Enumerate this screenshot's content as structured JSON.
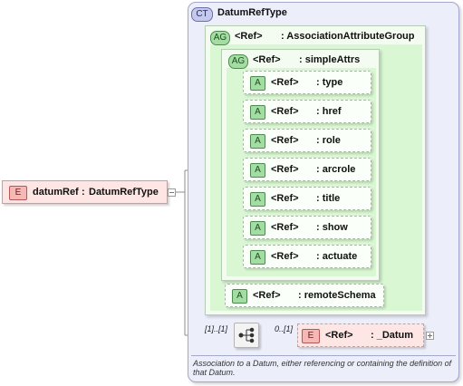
{
  "root_element": {
    "badge": "E",
    "name": "datumRef",
    "separator": ":",
    "type": "DatumRefType"
  },
  "complex_type": {
    "badge": "CT",
    "name": "DatumRefType"
  },
  "attribute_group_outer": {
    "badge": "AG",
    "ref": "<Ref>",
    "name": ": AssociationAttributeGroup"
  },
  "attribute_group_inner": {
    "badge": "AG",
    "ref": "<Ref>",
    "name": ": simpleAttrs"
  },
  "attributes": [
    {
      "badge": "A",
      "ref": "<Ref>",
      "name": ": type"
    },
    {
      "badge": "A",
      "ref": "<Ref>",
      "name": ": href"
    },
    {
      "badge": "A",
      "ref": "<Ref>",
      "name": ": role"
    },
    {
      "badge": "A",
      "ref": "<Ref>",
      "name": ": arcrole"
    },
    {
      "badge": "A",
      "ref": "<Ref>",
      "name": ": title"
    },
    {
      "badge": "A",
      "ref": "<Ref>",
      "name": ": show"
    },
    {
      "badge": "A",
      "ref": "<Ref>",
      "name": ": actuate"
    }
  ],
  "remote_schema": {
    "badge": "A",
    "ref": "<Ref>",
    "name": ": remoteSchema"
  },
  "sequence": {
    "cardinality_left": "[1]..[1]",
    "cardinality_right": "0..[1]"
  },
  "child_element": {
    "badge": "E",
    "ref": "<Ref>",
    "name": ": _Datum"
  },
  "documentation": "Association to a Datum, either referencing or containing the definition of that Datum."
}
